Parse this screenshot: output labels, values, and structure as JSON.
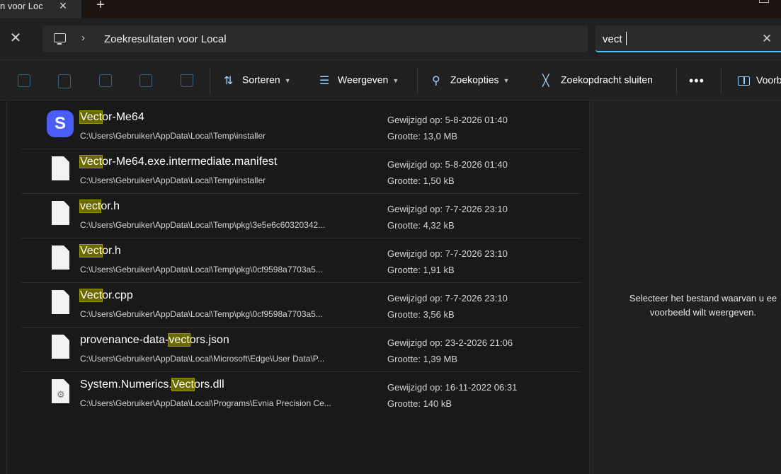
{
  "tab": {
    "title": "n voor Loc",
    "close_icon": "close-icon",
    "new_tab_icon": "plus-icon"
  },
  "address": {
    "location_icon": "this-pc-icon",
    "separator_icon": "chevron-right-icon",
    "breadcrumb": "Zoekresultaten voor Local"
  },
  "search": {
    "value": "vect",
    "clear_icon": "close-icon"
  },
  "commands": {
    "disabled_icons": [
      "copy-icon",
      "paste-icon",
      "rename-icon",
      "share-icon",
      "delete-icon"
    ],
    "sort_label": "Sorteren",
    "view_label": "Weergeven",
    "search_options_label": "Zoekopties",
    "close_search_label": "Zoekopdracht sluiten",
    "more_label": "•••",
    "preview_label": "Voorb"
  },
  "results": [
    {
      "icon": "app-icon",
      "pre": "",
      "match": "Vect",
      "post": "or-Me64",
      "path": "C:\\Users\\Gebruiker\\AppData\\Local\\Temp\\installer",
      "date": "Gewijzigd op: 5-8-2026 01:40",
      "size": "Grootte: 13,0 MB"
    },
    {
      "icon": "file-icon",
      "pre": "",
      "match": "Vect",
      "post": "or-Me64.exe.intermediate.manifest",
      "path": "C:\\Users\\Gebruiker\\AppData\\Local\\Temp\\installer",
      "date": "Gewijzigd op: 5-8-2026 01:40",
      "size": "Grootte: 1,50 kB"
    },
    {
      "icon": "file-icon",
      "pre": "",
      "match": "vect",
      "post": "or.h",
      "path": "C:\\Users\\Gebruiker\\AppData\\Local\\Temp\\pkg\\3e5e6c60320342...",
      "date": "Gewijzigd op: 7-7-2026 23:10",
      "size": "Grootte: 4,32 kB"
    },
    {
      "icon": "file-icon",
      "pre": "",
      "match": "Vect",
      "post": "or.h",
      "path": "C:\\Users\\Gebruiker\\AppData\\Local\\Temp\\pkg\\0cf9598a7703a5...",
      "date": "Gewijzigd op: 7-7-2026 23:10",
      "size": "Grootte: 1,91 kB"
    },
    {
      "icon": "file-icon",
      "pre": "",
      "match": "Vect",
      "post": "or.cpp",
      "path": "C:\\Users\\Gebruiker\\AppData\\Local\\Temp\\pkg\\0cf9598a7703a5...",
      "date": "Gewijzigd op: 7-7-2026 23:10",
      "size": "Grootte: 3,56 kB"
    },
    {
      "icon": "file-icon",
      "pre": "provenance-data-",
      "match": "vect",
      "post": "ors.json",
      "path": "C:\\Users\\Gebruiker\\AppData\\Local\\Microsoft\\Edge\\User Data\\P...",
      "date": "Gewijzigd op: 23-2-2026 21:06",
      "size": "Grootte: 1,39 MB"
    },
    {
      "icon": "dll-icon",
      "pre": "System.Numerics.",
      "match": "Vect",
      "post": "ors.dll",
      "path": "C:\\Users\\Gebruiker\\AppData\\Local\\Programs\\Evnia Precision Ce...",
      "date": "Gewijzigd op: 16-11-2022 06:31",
      "size": "Grootte: 140 kB"
    }
  ],
  "preview": {
    "line1": "Selecteer het bestand waarvan u ee",
    "line2": "voorbeeld wilt weergeven."
  },
  "colors": {
    "accent": "#4cc2ff",
    "highlight": "#6b6a00",
    "app_icon": "#4a5ef7"
  }
}
